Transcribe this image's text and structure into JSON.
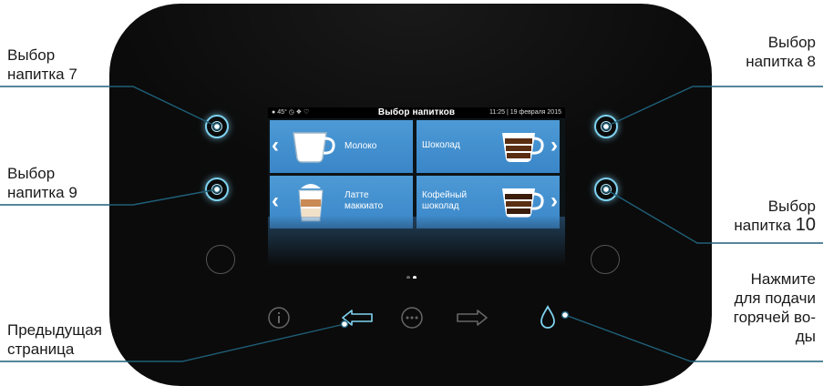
{
  "callouts": {
    "btn7": "Выбор напитка 7",
    "btn8": "Выбор напитка 8",
    "btn9": "Выбор напитка 9",
    "btn10_line1": "Выбор",
    "btn10_line2": "напитка",
    "btn10_num": "10",
    "prev": "Предыдущая страница",
    "water": "Нажмите для подачи горячей во-ды"
  },
  "screen": {
    "status_left": "45°",
    "title": "Выбор напитков",
    "time": "11:25 | 19 февраля 2015",
    "tiles": [
      {
        "label": "Молоко",
        "icon": "milk-cup-icon"
      },
      {
        "label": "Шоколад",
        "icon": "chocolate-cup-icon"
      },
      {
        "label": "Латте маккиато",
        "icon": "latte-glass-icon"
      },
      {
        "label": "Кофейный шоколад",
        "icon": "coffee-chocolate-cup-icon"
      }
    ],
    "page_indicator": {
      "pages": 2,
      "current": 2
    }
  },
  "bottom_icons": [
    "info-icon",
    "back-arrow-icon",
    "menu-icon",
    "forward-arrow-icon",
    "water-drop-icon"
  ],
  "colors": {
    "accent": "#7fd3f1",
    "tile": "#4592d0",
    "device": "#0b0b0b"
  }
}
